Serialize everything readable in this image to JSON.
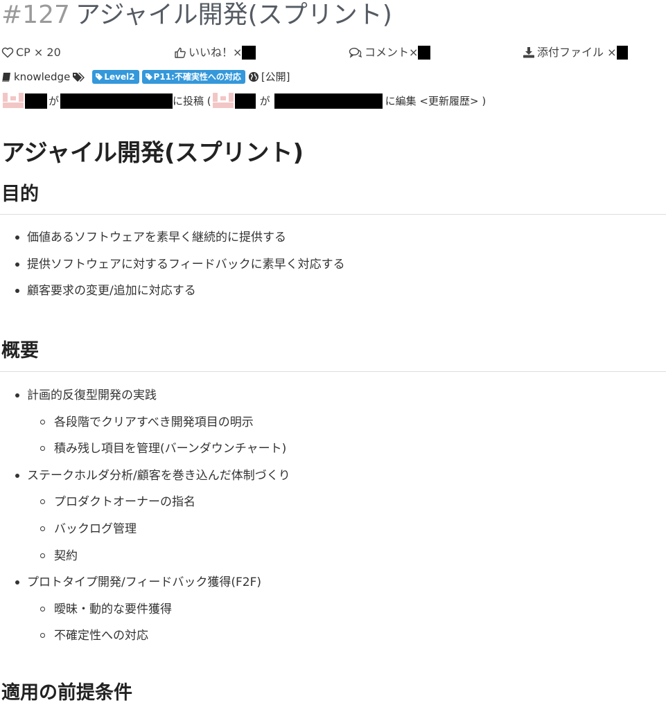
{
  "header": {
    "number": "#127",
    "title": "アジャイル開発(スプリント)"
  },
  "stats": {
    "cp_label": "CP × 20",
    "like_label": "いいね！×",
    "comment_label": "コメント×",
    "attach_label": "添付ファイル ×"
  },
  "meta": {
    "type_label": "knowledge",
    "tags": [
      "Level2",
      "P11:不確実性への対応"
    ],
    "visibility": "[公開]"
  },
  "author": {
    "posted_by": "が",
    "posted_suffix": "に投稿 (",
    "edited_by": "が",
    "edited_suffix": "に編集 <更新履歴> )"
  },
  "article": {
    "title": "アジャイル開発(スプリント)",
    "sections": [
      {
        "heading": "目的",
        "items": [
          "価値あるソフトウェアを素早く継続的に提供する",
          "提供ソフトウェアに対するフィードバックに素早く対応する",
          "顧客要求の変更/追加に対応する"
        ]
      },
      {
        "heading": "概要",
        "items": [
          "計画的反復型開発の実践",
          "各段階でクリアすべき開発項目の明示",
          "積み残し項目を管理(バーンダウンチャート)",
          "ステークホルダ分析/顧客を巻き込んだ体制づくり",
          "プロダクトオーナーの指名",
          "バックログ管理",
          "契約",
          "プロトタイプ開発/フィードバック獲得(F2F)",
          "曖昧・動的な要件獲得",
          "不確定性への対応"
        ]
      },
      {
        "heading": "適用の前提条件",
        "items": []
      }
    ]
  },
  "colors": {
    "badge": "#3498db",
    "title_number": "#9a9a9a",
    "avatar": "#f3c6c6"
  }
}
